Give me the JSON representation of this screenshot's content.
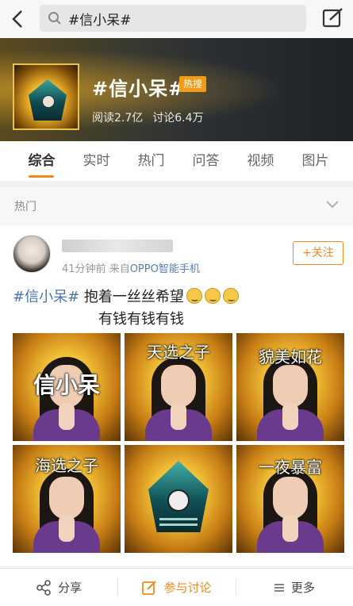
{
  "search": {
    "query": "#信小呆#"
  },
  "topic": {
    "title": "#信小呆#",
    "badge": "热搜",
    "reads": "阅读2.7亿",
    "discussions": "讨论6.4万"
  },
  "tabs": [
    "综合",
    "实时",
    "热门",
    "问答",
    "视频",
    "图片"
  ],
  "section": {
    "label": "热门"
  },
  "post": {
    "meta_time": "41分钟前",
    "meta_source_prefix": "来自",
    "meta_source": "OPPO智能手机",
    "follow_label": "+关注",
    "hashtag": "#信小呆#",
    "text_line1": " 抱着一丝丝希望",
    "text_line2": "有钱有钱有钱",
    "images": [
      {
        "caption": "信小呆"
      },
      {
        "caption": "天选之子"
      },
      {
        "caption": "貌美如花"
      },
      {
        "caption": "海选之子"
      },
      {
        "caption": ""
      },
      {
        "caption": "一夜暴富"
      }
    ]
  },
  "bottom": {
    "share": "分享",
    "discuss": "参与讨论",
    "more": "更多"
  },
  "colors": {
    "accent": "#f08a1a",
    "link": "#4a74b0"
  }
}
